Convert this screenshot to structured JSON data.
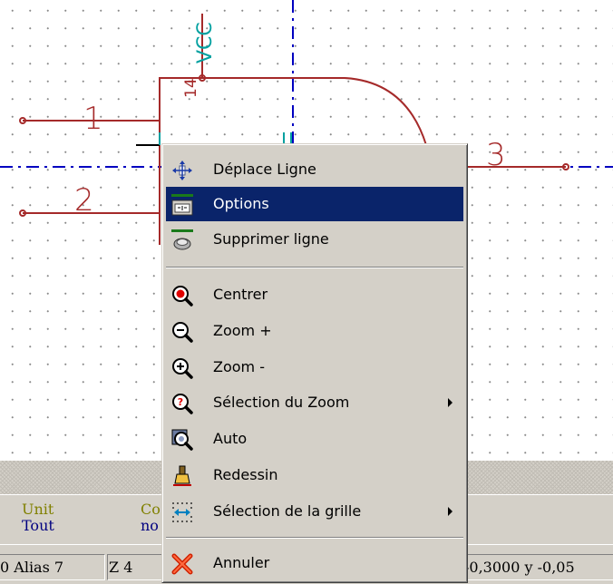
{
  "schematic": {
    "pin_numbers": [
      "1",
      "2",
      "3"
    ],
    "vcc_label": "VCC",
    "vcc_pin": "14",
    "colors": {
      "wire": "#a52a2a",
      "axis": "#0000c0",
      "label": "#00a0a0"
    }
  },
  "context_menu": {
    "items": [
      {
        "label": "Déplace Ligne",
        "icon": "move-line-icon"
      },
      {
        "label": "Options",
        "icon": "options-icon",
        "highlighted": true
      },
      {
        "label": "Supprimer ligne",
        "icon": "delete-line-icon"
      },
      {
        "label": "Centrer",
        "icon": "center-icon"
      },
      {
        "label": "Zoom +",
        "icon": "zoom-in-icon"
      },
      {
        "label": "Zoom -",
        "icon": "zoom-out-icon"
      },
      {
        "label": "Sélection du Zoom",
        "icon": "zoom-select-icon",
        "submenu": true
      },
      {
        "label": "Auto",
        "icon": "zoom-auto-icon"
      },
      {
        "label": "Redessin",
        "icon": "redraw-icon"
      },
      {
        "label": "Sélection de la grille",
        "icon": "grid-select-icon",
        "submenu": true
      },
      {
        "label": "Annuler",
        "icon": "cancel-icon"
      }
    ],
    "highlight_color": "#0a246a"
  },
  "message_panel": {
    "col1_header": "Unit",
    "col1_value": "Tout",
    "col2_header": "Co",
    "col2_value": "no"
  },
  "status_bar": {
    "fields": [
      "0 Alias 7",
      "Z 4",
      "-0,3000  y -0,05"
    ]
  }
}
